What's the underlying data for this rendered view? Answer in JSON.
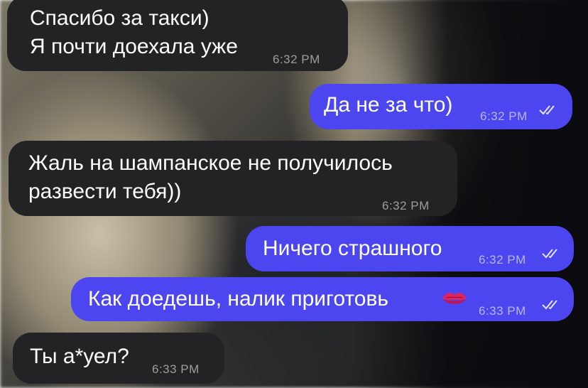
{
  "messages": [
    {
      "id": "m1",
      "direction": "incoming",
      "lines": [
        "Спасибо за такси)",
        "Я почти доехала уже"
      ],
      "time": "6:32 PM"
    },
    {
      "id": "m2",
      "direction": "outgoing",
      "lines": [
        "Да не за что)"
      ],
      "time": "6:32 PM",
      "read": true
    },
    {
      "id": "m3",
      "direction": "incoming",
      "lines": [
        "Жаль на шампанское не получилось",
        "развести тебя))"
      ],
      "time": "6:32 PM"
    },
    {
      "id": "m4",
      "direction": "outgoing",
      "lines": [
        "Ничего страшного"
      ],
      "time": "6:32 PM",
      "read": true
    },
    {
      "id": "m5",
      "direction": "outgoing",
      "lines": [
        "Как доедешь, налик приготовь"
      ],
      "emoji": "kiss-mark-icon",
      "time": "6:33 PM",
      "read": true
    },
    {
      "id": "m6",
      "direction": "incoming",
      "lines": [
        "Ты а*уел?"
      ],
      "time": "6:33 PM"
    }
  ],
  "colors": {
    "incoming_bubble": "#232325",
    "outgoing_bubble": "#4c46f0",
    "text": "#ffffff"
  }
}
